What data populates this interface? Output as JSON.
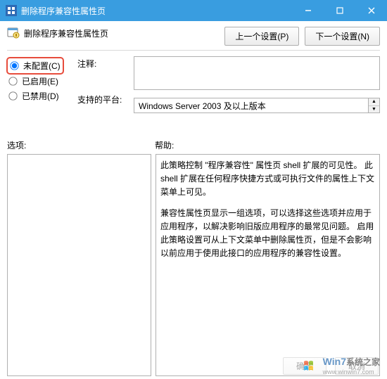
{
  "window": {
    "title": "删除程序兼容性属性页"
  },
  "header": {
    "policy_title": "删除程序兼容性属性页",
    "prev_btn": "上一个设置(P)",
    "next_btn": "下一个设置(N)"
  },
  "radios": {
    "not_configured": "未配置(C)",
    "enabled": "已启用(E)",
    "disabled": "已禁用(D)",
    "selected": "not_configured"
  },
  "fields": {
    "comment_label": "注释:",
    "comment_value": "",
    "platform_label": "支持的平台:",
    "platform_value": "Windows Server 2003 及以上版本"
  },
  "sections": {
    "options_label": "选项:",
    "help_label": "帮助:"
  },
  "help": {
    "p1": "此策略控制 \"程序兼容性\" 属性页 shell 扩展的可见性。 此 shell 扩展在任何程序快捷方式或可执行文件的属性上下文菜单上可见。",
    "p2": "兼容性属性页显示一组选项，可以选择这些选项并应用于应用程序，以解决影响旧版应用程序的最常见问题。 启用此策略设置可从上下文菜单中删除属性页，但是不会影响以前应用于使用此接口的应用程序的兼容性设置。"
  },
  "footer": {
    "ok": "确定",
    "cancel": "取消"
  },
  "watermark": {
    "brand1": "Win7",
    "brand2": "系统之家",
    "url": "www.winwin7.com"
  }
}
